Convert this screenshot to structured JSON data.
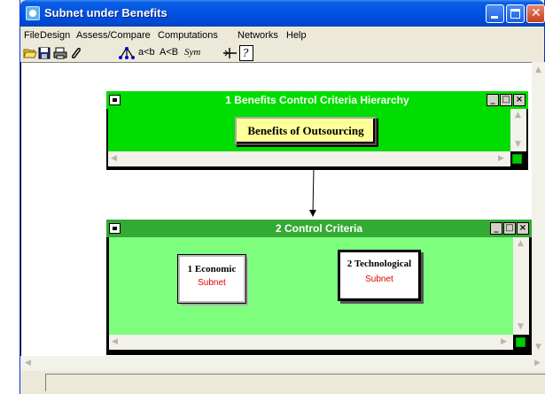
{
  "window": {
    "title": "Subnet under Benefits"
  },
  "menu": [
    "File",
    "Design",
    "Assess/Compare",
    "Computations",
    "Networks",
    "Help"
  ],
  "toolbar": {
    "icons": [
      "open-folder-icon",
      "save-disk-icon",
      "print-icon",
      "paperclip-icon",
      "hierarchy-icon",
      "pair-icon"
    ],
    "compare_a": "a<b",
    "compare_b": "A<B",
    "sym": "Sym"
  },
  "hierarchy_window": {
    "title": "1 Benefits Control Criteria Hierarchy",
    "node": "Benefits of Outsourcing",
    "color": "#00dd00"
  },
  "criteria_window": {
    "title": "2 Control Criteria",
    "color": "#7dff7d",
    "title_color": "#33aa33",
    "nodes": [
      {
        "name": "1 Economic",
        "sub": "Subnet"
      },
      {
        "name": "2 Technological",
        "sub": "Subnet"
      }
    ]
  }
}
